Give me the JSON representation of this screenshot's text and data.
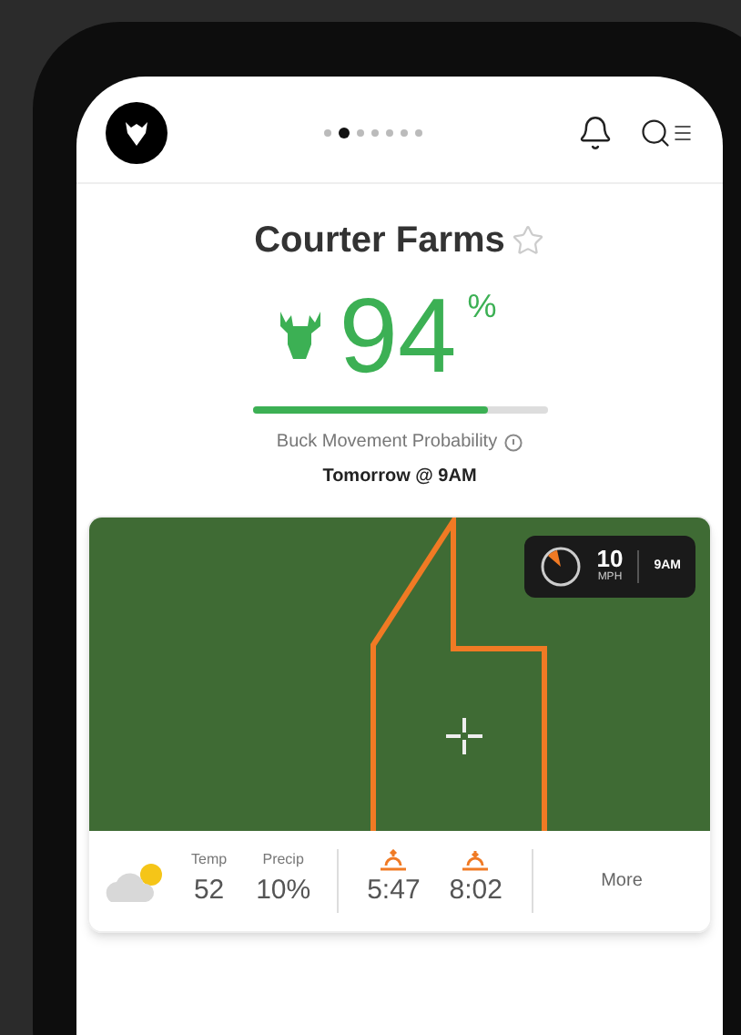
{
  "pager": [
    {
      "selected": false
    },
    {
      "selected": true
    },
    {
      "selected": false
    },
    {
      "selected": false
    },
    {
      "selected": false
    },
    {
      "selected": false
    },
    {
      "selected": false
    }
  ],
  "property": {
    "name": "Courter Farms",
    "favorite": false
  },
  "probability": {
    "value": "94",
    "unit": "%",
    "level": 0.8,
    "label": "Buck Movement Probability",
    "time": "Tomorrow @ 9AM"
  },
  "wind": {
    "speed": "10",
    "unit": "MPH",
    "time": "9AM"
  },
  "weather": [
    {
      "label": "Temp",
      "value": "52"
    },
    {
      "label": "Precip",
      "value": "10%"
    }
  ],
  "sun": [
    {
      "kind": "sunrise",
      "value": "5:47"
    },
    {
      "kind": "sunset",
      "value": "8:02"
    }
  ],
  "more": "More"
}
